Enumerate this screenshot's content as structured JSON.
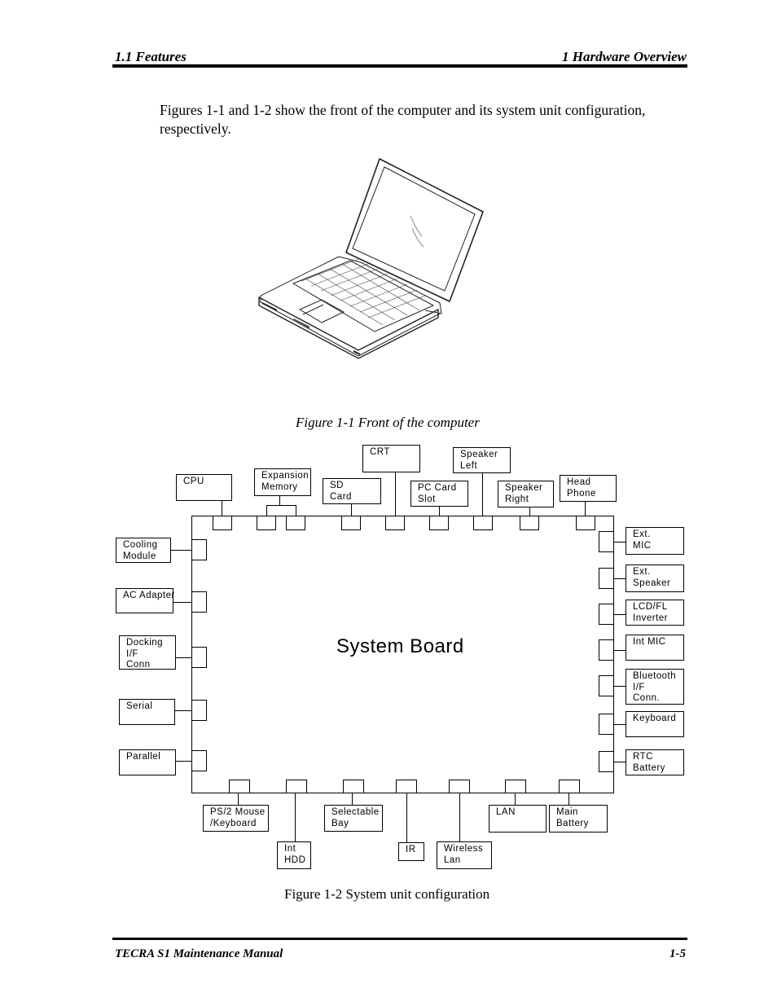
{
  "header": {
    "section": "1.1  Features",
    "chapter": "1  Hardware Overview"
  },
  "intro_text": "Figures 1-1 and 1-2 show the front of the computer and its system unit configuration, respectively.",
  "figure1": {
    "image": "laptop-front-illustration",
    "caption": "Figure 1-1  Front of the computer"
  },
  "figure2": {
    "caption": "Figure 1-2  System unit configuration",
    "board_label": "System Board",
    "top": [
      {
        "id": "cpu",
        "label": "CPU"
      },
      {
        "id": "expansion-memory",
        "label": "Expansion\nMemory"
      },
      {
        "id": "sd-card",
        "label": "SD\nCard"
      },
      {
        "id": "crt",
        "label": "CRT"
      },
      {
        "id": "pc-card-slot",
        "label": "PC Card\nSlot"
      },
      {
        "id": "speaker-left",
        "label": "Speaker\nLeft"
      },
      {
        "id": "speaker-right",
        "label": "Speaker\nRight"
      },
      {
        "id": "head-phone",
        "label": "Head\nPhone"
      }
    ],
    "left": [
      {
        "id": "cooling-module",
        "label": "Cooling\nModule"
      },
      {
        "id": "ac-adapter",
        "label": "AC Adapter"
      },
      {
        "id": "docking-if-conn",
        "label": "Docking\nI/F\nConn"
      },
      {
        "id": "serial",
        "label": "Serial"
      },
      {
        "id": "parallel",
        "label": "Parallel"
      }
    ],
    "right": [
      {
        "id": "ext-mic",
        "label": "Ext.\nMIC"
      },
      {
        "id": "ext-speaker",
        "label": "Ext.\nSpeaker"
      },
      {
        "id": "lcd-fl-inverter",
        "label": "LCD/FL\nInverter"
      },
      {
        "id": "int-mic",
        "label": "Int MIC"
      },
      {
        "id": "bluetooth-if-conn",
        "label": "Bluetooth\nI/F\nConn."
      },
      {
        "id": "keyboard",
        "label": "Keyboard"
      },
      {
        "id": "rtc-battery",
        "label": "RTC\nBattery"
      }
    ],
    "bottom": [
      {
        "id": "ps2-mouse-keyboard",
        "label": "PS/2 Mouse\n/Keyboard"
      },
      {
        "id": "int-hdd",
        "label": "Int\nHDD"
      },
      {
        "id": "selectable-bay",
        "label": "Selectable\nBay"
      },
      {
        "id": "ir",
        "label": "IR"
      },
      {
        "id": "wireless-lan",
        "label": "Wireless\nLan"
      },
      {
        "id": "lan",
        "label": "LAN"
      },
      {
        "id": "main-battery",
        "label": "Main\nBattery"
      }
    ]
  },
  "footer": {
    "manual": "TECRA S1   Maintenance Manual",
    "page": "1-5"
  }
}
